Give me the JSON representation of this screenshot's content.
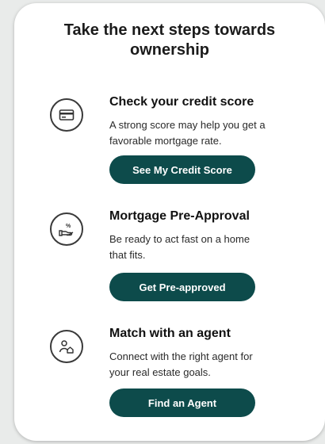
{
  "card": {
    "heading_line1": "Take the next steps towards",
    "heading_line2": "ownership"
  },
  "steps": [
    {
      "icon": "credit-card-icon",
      "title": "Check your credit score",
      "desc_line1": "A strong score may help you get a",
      "desc_line2": "favorable mortgage rate.",
      "button": "See My Credit Score"
    },
    {
      "icon": "hand-percent-icon",
      "title": "Mortgage Pre-Approval",
      "desc_line1": "Be ready to act fast on a home",
      "desc_line2": "that fits.",
      "button": "Get Pre-approved"
    },
    {
      "icon": "agent-home-icon",
      "title": "Match with an agent",
      "desc_line1": "Connect with the right agent for",
      "desc_line2": "your real estate goals.",
      "button": "Find an Agent"
    }
  ],
  "colors": {
    "button_bg": "#0d4b4b",
    "button_text": "#ffffff",
    "card_bg": "#ffffff",
    "page_bg": "#e9ebea"
  }
}
